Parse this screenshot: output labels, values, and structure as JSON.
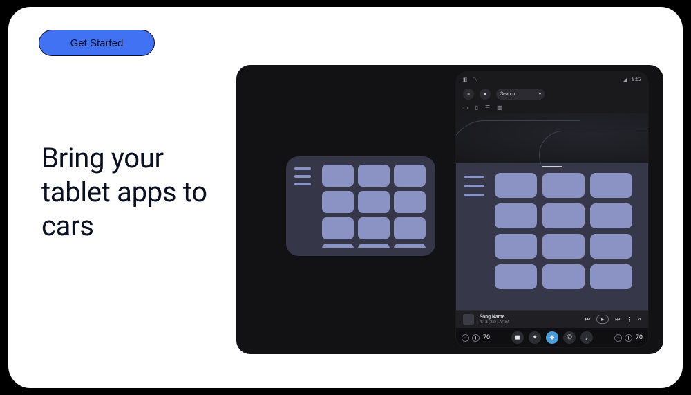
{
  "cta": {
    "label": "Get Started"
  },
  "headline": "Bring your tablet apps to cars",
  "car": {
    "status": {
      "time": "8:52",
      "signal_icon": "signal-icon"
    },
    "search": {
      "placeholder": "Search"
    },
    "now_playing": {
      "title": "Song Name",
      "subtitle": "4:18 (22) | Artist"
    },
    "sysbar": {
      "temp_left": "70",
      "temp_right": "70"
    }
  }
}
